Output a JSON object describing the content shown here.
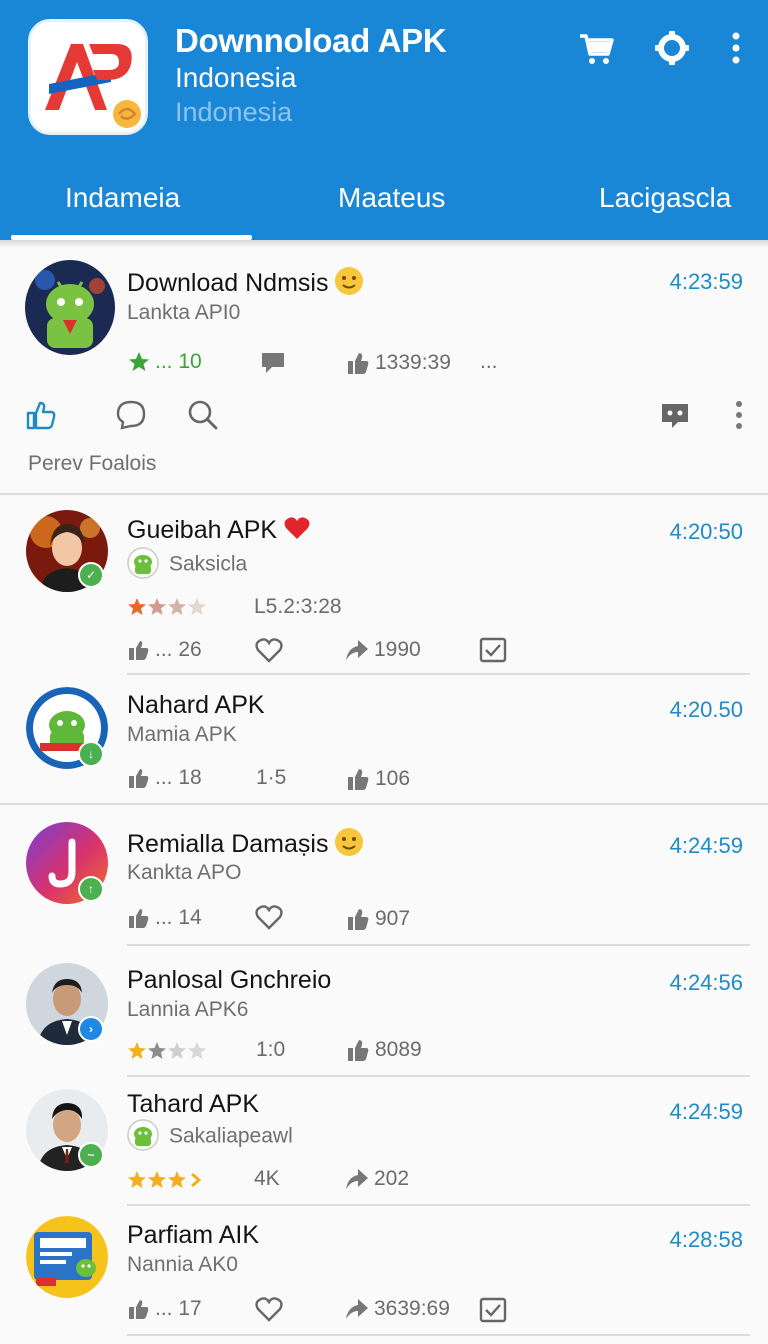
{
  "header": {
    "title": "Downnoload APK",
    "subtitle": "Indonesia",
    "subtitle2": "Indonesia",
    "icons": [
      "cart-icon",
      "gear-icon",
      "more-vert-icon"
    ],
    "color": "#1a86d6"
  },
  "tabs": [
    {
      "label": "Indameia",
      "selected": true
    },
    {
      "label": "Maateus",
      "selected": false
    },
    {
      "label": "Lacigascla",
      "selected": false
    }
  ],
  "feed": [
    {
      "name": "Download Ndmsis",
      "time": "4:23:59",
      "subtitle": "Lankta API0",
      "rating_dots": "... 10",
      "views": "1339:39",
      "more": "...",
      "footer": "Perev Foalois"
    },
    {
      "name": "Gueibah APK",
      "time": "4:20:50",
      "subtitle": "Saksicla",
      "stars": 3,
      "version": "L5.2:3:28",
      "likes": "... 26",
      "shares": "1990"
    },
    {
      "name": "Nahard APK",
      "time": "4:20.50",
      "subtitle": "Mamia APK",
      "likes": "... 18",
      "ratio": "1·5",
      "thumbs": "106"
    },
    {
      "name": "Remialla Damaṣis",
      "time": "4:24:59",
      "subtitle": "Kankta APO",
      "likes": "... 14",
      "thumbs": "907"
    },
    {
      "name": "Panlosal Gnchreio",
      "time": "4:24:56",
      "subtitle": "Lannia APK6",
      "stars": 2,
      "ratio": "1:0",
      "thumbs": "8089"
    },
    {
      "name": "Tahard APK",
      "time": "4:24:59",
      "subtitle": "Sakaliapeawl",
      "stars": 3,
      "count": "4K",
      "shares": "202"
    },
    {
      "name": "Parfiam AIK",
      "time": "4:28:58",
      "subtitle": "Nannia AK0",
      "likes": "... 17",
      "shares": "3639:69"
    }
  ]
}
